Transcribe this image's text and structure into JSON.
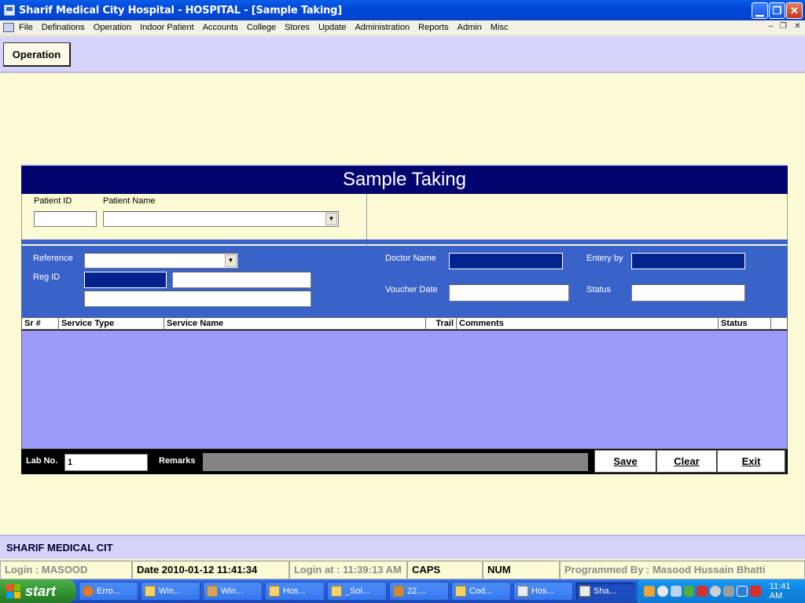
{
  "window": {
    "title": "Sharif Medical City Hospital - HOSPITAL - [Sample Taking]"
  },
  "menu": [
    "File",
    "Definations",
    "Operation",
    "Indoor Patient",
    "Accounts",
    "College",
    "Stores",
    "Update",
    "Administration",
    "Reports",
    "Admin",
    "Misc"
  ],
  "toolbar": {
    "operation_label": "Operation"
  },
  "form": {
    "title": "Sample Taking",
    "patient_id_label": "Patient ID",
    "patient_name_label": "Patient Name",
    "reference_label": "Reference",
    "reg_id_label": "Reg ID",
    "doctor_name_label": "Doctor Name",
    "voucher_date_label": "Voucher Date",
    "entery_by_label": "Entery by",
    "status_label": "Status",
    "grid_columns": [
      "Sr #",
      "Service Type",
      "Service Name",
      "Trail",
      "Comments",
      "Status"
    ],
    "lab_no_label": "Lab No.",
    "lab_no_value": "1",
    "remarks_label": "Remarks",
    "save_label": "Save",
    "clear_label": "Clear",
    "exit_label": "Exit"
  },
  "status": {
    "hospital": "SHARIF MEDICAL CIT",
    "login": "Login :  MASOOD",
    "date": "Date 2010-01-12 11:41:34",
    "login_at": "Login at : 11:39:13 AM",
    "caps": "CAPS",
    "num": "NUM",
    "programmed_by": "Programmed By : Masood Hussain Bhatti"
  },
  "taskbar": {
    "start": "start",
    "tasks": [
      "Erro...",
      "Win...",
      "Win...",
      "Hos...",
      "_Sol...",
      "22....",
      "Cod...",
      "Hos...",
      "Sha..."
    ],
    "clock": "11:41 AM"
  }
}
